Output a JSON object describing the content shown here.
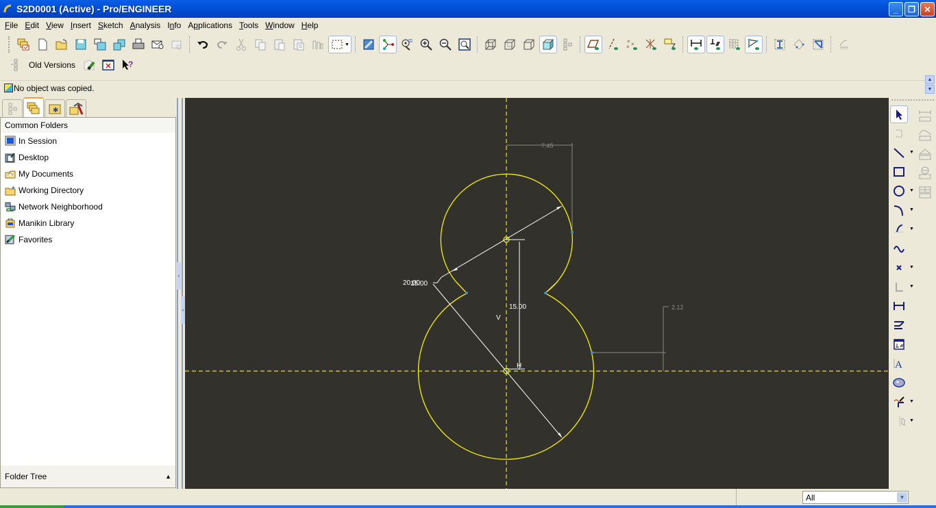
{
  "window": {
    "title": "S2D0001 (Active) - Pro/ENGINEER",
    "buttons": [
      "minimize",
      "restore",
      "close"
    ]
  },
  "menu": [
    {
      "label": "File",
      "mnemonic": "F"
    },
    {
      "label": "Edit",
      "mnemonic": "E"
    },
    {
      "label": "View",
      "mnemonic": "V"
    },
    {
      "label": "Insert",
      "mnemonic": "I"
    },
    {
      "label": "Sketch",
      "mnemonic": "S"
    },
    {
      "label": "Analysis",
      "mnemonic": "A"
    },
    {
      "label": "Info",
      "mnemonic": "n"
    },
    {
      "label": "Applications",
      "mnemonic": "p"
    },
    {
      "label": "Tools",
      "mnemonic": "T"
    },
    {
      "label": "Window",
      "mnemonic": "W"
    },
    {
      "label": "Help",
      "mnemonic": "H"
    }
  ],
  "toolbar": {
    "row1": [
      "select-window-icon",
      "new-icon",
      "open-icon",
      "save-icon",
      "save-copy-icon",
      "backup-icon",
      "print-icon",
      "send-mail-icon",
      "send-mail-link-icon",
      "undo-icon",
      "redo-icon",
      "cut-icon",
      "copy-icon",
      "paste-icon",
      "paste-special-icon",
      "regenerate-icon",
      "selection-box-icon",
      "repaint-icon",
      "sketch-orient-icon",
      "spin-center-icon",
      "zoom-in-icon",
      "zoom-out-icon",
      "refit-icon",
      "wireframe-icon",
      "hidden-line-icon",
      "no-hidden-icon",
      "shading-icon",
      "model-tree-icon",
      "datum-planes-icon",
      "datum-axes-icon",
      "datum-points-icon",
      "datum-csys-icon",
      "annotation-icon",
      "display-dims-icon",
      "display-constraints-icon",
      "display-grid-icon",
      "display-vertices-icon",
      "sketch-diagnostics-icon",
      "overlapping-geometry-icon",
      "shade-closed-loops-icon",
      "highlight-open-ends-icon"
    ],
    "old_versions_label": "Old Versions"
  },
  "message": {
    "text": "No object was copied."
  },
  "navigator": {
    "tabs": [
      "model-tree-tab",
      "folder-browser-tab",
      "favorites-tab",
      "connections-tab"
    ],
    "active_tab": 1,
    "header": "Common Folders",
    "items": [
      {
        "label": "In Session",
        "icon": "in-session-icon"
      },
      {
        "label": "Desktop",
        "icon": "desktop-icon"
      },
      {
        "label": "My Documents",
        "icon": "my-documents-icon"
      },
      {
        "label": "Working Directory",
        "icon": "working-directory-icon"
      },
      {
        "label": "Network Neighborhood",
        "icon": "network-neighborhood-icon"
      },
      {
        "label": "Manikin Library",
        "icon": "manikin-library-icon"
      },
      {
        "label": "Favorites",
        "icon": "favorites-icon"
      }
    ],
    "footer": "Folder Tree"
  },
  "sketch": {
    "colors": {
      "background": "#33312b",
      "geometry": "#f2f200",
      "strong_dim": "#ffffff",
      "weak_dim": "#8a8a82",
      "centerline": "#e6dc2a",
      "vertex": "#4a8ac8"
    },
    "dimensions": {
      "top_diameter": "20.00",
      "bottom_diameter": "15.00",
      "center_distance": "15.00",
      "weak_horizontal": "7.45",
      "weak_vertical": "2.12"
    },
    "constraint_labels": {
      "vertical": "V",
      "horizontal": "H"
    }
  },
  "right_toolbar": [
    "select-icon",
    "construction-mode-icon",
    "line-icon",
    "rectangle-icon",
    "circle-icon",
    "arc-icon",
    "fillet-icon",
    "spline-icon",
    "point-icon",
    "csys-icon",
    "dimension-icon",
    "modify-icon",
    "constraints-icon",
    "text-icon",
    "palette-icon",
    "trim-icon",
    "mirror-icon"
  ],
  "status": {
    "filter_value": "All"
  }
}
